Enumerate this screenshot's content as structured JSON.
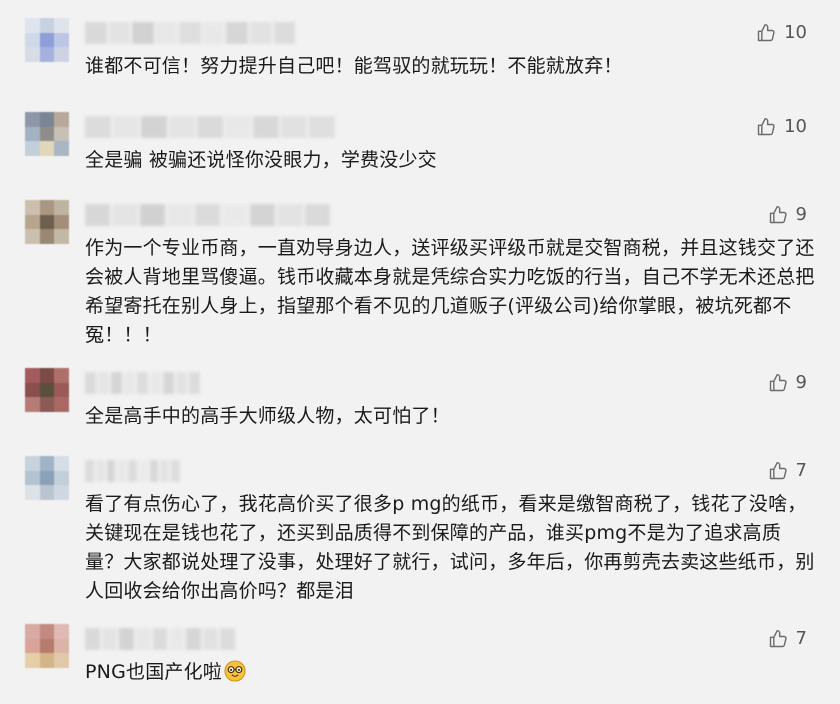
{
  "comments": [
    {
      "text": "谁都不可信！努力提升自己吧！能驾驭的就玩玩！不能就放弃！",
      "likes": "10",
      "avatar_colors": [
        "#dfe5ee",
        "#c6d1e2",
        "#dfe4ec",
        "#cfd9ea",
        "#8d9ed9",
        "#bcc7e5",
        "#d8dce6",
        "#a6b2dd",
        "#cdd3e3"
      ],
      "name_colors": [
        "#d7d7d7",
        "#e2e2e2",
        "#cfcfcf",
        "#e6e6e6",
        "#dcdcdc",
        "#e8e8e8",
        "#d3d3d3",
        "#e1e1e1",
        "#dadada"
      ]
    },
    {
      "text": "全是骗  被骗还说怪你没眼力，学费没少交",
      "likes": "10",
      "avatar_colors": [
        "#8d97a8",
        "#7b8595",
        "#b7a99a",
        "#a3b1c3",
        "#8f8d8a",
        "#c6c0b5",
        "#c2cfd9",
        "#e3d7b9",
        "#a9b6c4"
      ],
      "name_colors": [
        "#dadada",
        "#e5e5e5",
        "#d0d0d0",
        "#e3e3e3",
        "#d8d8d8",
        "#e7e7e7",
        "#d6d6d6",
        "#e0e0e0",
        "#dcdcdc"
      ]
    },
    {
      "text": "作为一个专业币商，一直劝导身边人，送评级买评级币就是交智商税，并且这钱交了还会被人背地里骂傻逼。钱币收藏本身就是凭综合实力吃饭的行当，自己不学无术还总把希望寄托在别人身上，指望那个看不见的几道贩子(评级公司)给你掌眼，被坑死都不冤！！！",
      "likes": "9",
      "avatar_colors": [
        "#cdbfad",
        "#a99784",
        "#bfb3a2",
        "#b7a58e",
        "#6f5f4e",
        "#a38f79",
        "#cbbfb0",
        "#9a8774",
        "#c3b7a7"
      ],
      "name_colors": [
        "#d5d5d5",
        "#e3e3e3",
        "#cecece",
        "#e6e6e6",
        "#d9d9d9",
        "#e9e9e9",
        "#d1d1d1",
        "#e2e2e2",
        "#d8d8d8"
      ]
    },
    {
      "text": "全是高手中的高手大师级人物，太可怕了！",
      "likes": "9",
      "avatar_colors": [
        "#a45b5e",
        "#7c4b47",
        "#b0706a",
        "#8a4e4c",
        "#5a4f3a",
        "#9a5a55",
        "#b77b76",
        "#8c5a54",
        "#a86963"
      ],
      "name_colors": [
        "#d8d8d8",
        "#e4e4e4",
        "#d2d2d2",
        "#e7e7e7",
        "#dbdbdb",
        "#e8e8e8",
        "#d4d4d4",
        "#e1e1e1",
        "#dadada"
      ]
    },
    {
      "text": "看了有点伤心了，我花高价买了很多p mg的纸币，看来是缴智商税了，钱花了没啥，关键现在是钱也花了，还买到品质得不到保障的产品，谁买pmg不是为了追求高质量？大家都说处理了没事，处理好了就行，试问，多年后，你再剪壳去卖这些纸币，别人回收会给你出高价吗？都是泪",
      "likes": "7",
      "avatar_colors": [
        "#c8d2dc",
        "#9fb4c8",
        "#d6dde4",
        "#b4c3d1",
        "#8aa1b8",
        "#c2ced9",
        "#dce2e8",
        "#b9c6d2",
        "#cfd8e0"
      ],
      "name_colors": [
        "#d9d9d9",
        "#e4e4e4",
        "#d3d3d3",
        "#e6e6e6",
        "#dadada",
        "#e9e9e9",
        "#d5d5d5",
        "#e1e1e1",
        "#dbdbdb"
      ]
    },
    {
      "text": "PNG也国产化啦",
      "likes": "7",
      "emoji": "🤓",
      "avatar_colors": [
        "#d9a9a3",
        "#c4897f",
        "#e0bab2",
        "#d8a49a",
        "#b57c6e",
        "#dcb3a7",
        "#e6cfa6",
        "#d3b588",
        "#e1c9a8"
      ],
      "name_colors": [
        "#d7d7d7",
        "#e3e3e3",
        "#d0d0d0",
        "#e6e6e6",
        "#d9d9d9",
        "#e8e8e8",
        "#d3d3d3",
        "#e0e0e0",
        "#dadada"
      ]
    }
  ],
  "icons": {
    "like": "thumbs-up-icon",
    "emoji": "nerd-face-icon"
  },
  "colors": {
    "background": "#f2f2f2",
    "text": "#1a1a1a",
    "like": "#6b6b6b"
  }
}
